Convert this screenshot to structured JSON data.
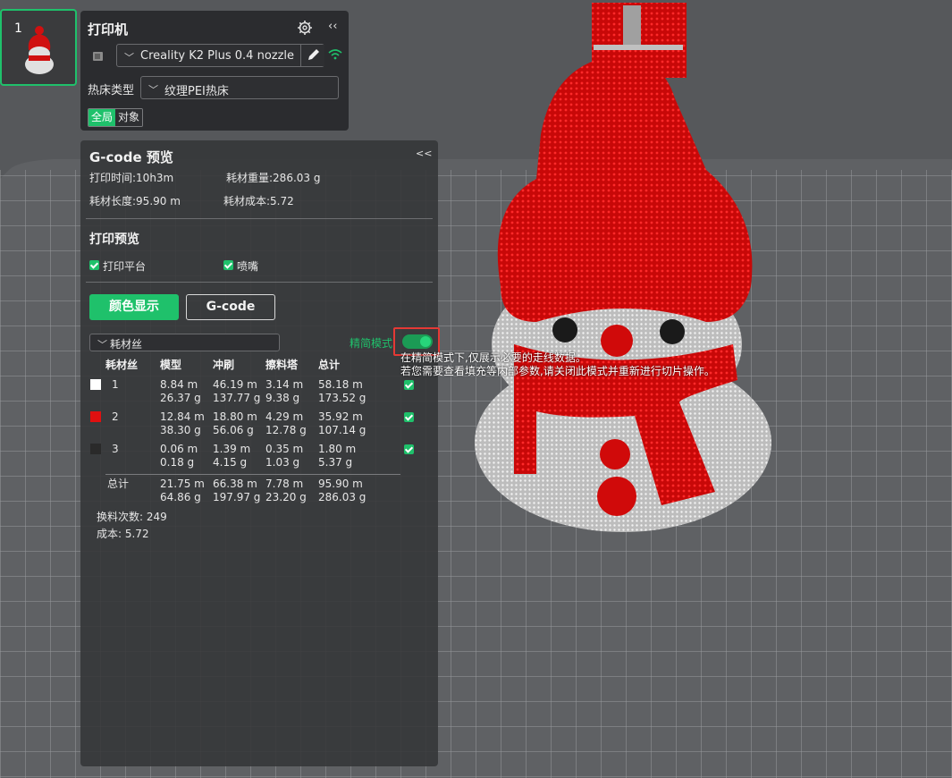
{
  "plate": {
    "number": "1"
  },
  "printer": {
    "title": "打印机",
    "model": "Creality K2 Plus 0.4 nozzle",
    "bed_label": "热床类型",
    "bed_value": "纹理PEI热床",
    "scope_global": "全局",
    "scope_object": "对象"
  },
  "gcode": {
    "title": "G-code 预览",
    "collapse": "<<",
    "print_time": "打印时间:10h3m",
    "filament_weight": "耗材重量:286.03 g",
    "filament_length": "耗材长度:95.90 m",
    "filament_cost": "耗材成本:5.72",
    "preview_title": "打印预览",
    "chk_plate": "打印平台",
    "chk_nozzle": "喷嘴",
    "btn_color": "颜色显示",
    "btn_gcode": "G-code",
    "filament_dropdown": "耗材丝",
    "compact_mode": "精简模式",
    "tooltip_line1": "在精简模式下,仅展示必要的走线数据。",
    "tooltip_line2": "若您需要查看填充等内部参数,请关闭此模式并重新进行切片操作。",
    "table": {
      "headers": [
        "耗材丝",
        "模型",
        "冲刷",
        "擦料塔",
        "总计"
      ],
      "rows": [
        {
          "id": "1",
          "color": "#ffffff",
          "model": [
            "8.84 m",
            "26.37 g"
          ],
          "flush": [
            "46.19 m",
            "137.77 g"
          ],
          "tower": [
            "3.14 m",
            "9.38 g"
          ],
          "total": [
            "58.18 m",
            "173.52 g"
          ]
        },
        {
          "id": "2",
          "color": "#e01010",
          "model": [
            "12.84 m",
            "38.30 g"
          ],
          "flush": [
            "18.80 m",
            "56.06 g"
          ],
          "tower": [
            "4.29 m",
            "12.78 g"
          ],
          "total": [
            "35.92 m",
            "107.14 g"
          ]
        },
        {
          "id": "3",
          "color": "#2a2a2a",
          "model": [
            "0.06 m",
            "0.18 g"
          ],
          "flush": [
            "1.39 m",
            "4.15 g"
          ],
          "tower": [
            "0.35 m",
            "1.03 g"
          ],
          "total": [
            "1.80 m",
            "5.37 g"
          ]
        }
      ],
      "sum_label": "总计",
      "sum": {
        "model": [
          "21.75 m",
          "64.86 g"
        ],
        "flush": [
          "66.38 m",
          "197.97 g"
        ],
        "tower": [
          "7.78 m",
          "23.20 g"
        ],
        "total": [
          "95.90 m",
          "286.03 g"
        ]
      }
    },
    "changes": "换料次数:  249",
    "cost": "成本:  5.72"
  },
  "colors": {
    "accent": "#1fc16b",
    "model_red": "#d40f0f",
    "model_white": "#dcdcdc"
  }
}
